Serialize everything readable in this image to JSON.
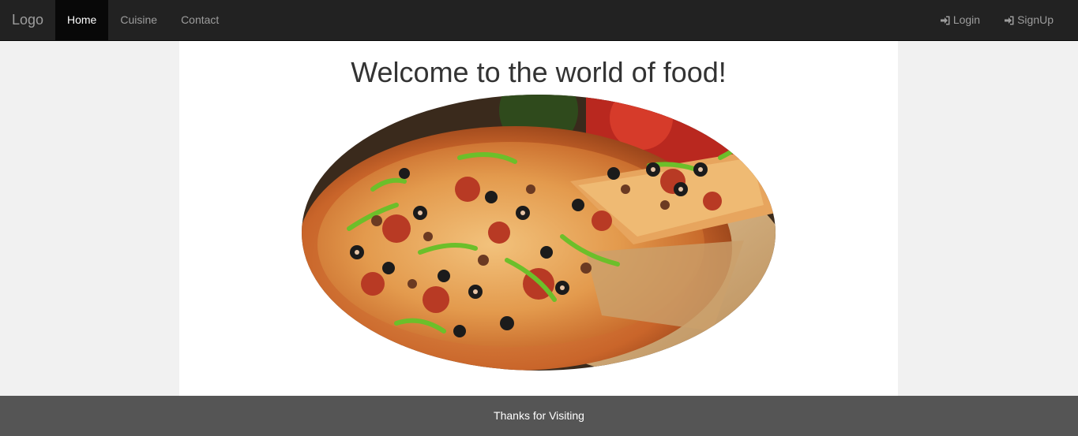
{
  "navbar": {
    "brand": "Logo",
    "items": [
      {
        "label": "Home",
        "active": true
      },
      {
        "label": "Cuisine",
        "active": false
      },
      {
        "label": "Contact",
        "active": false
      }
    ],
    "right_items": [
      {
        "label": "Login",
        "icon": "log-in-icon"
      },
      {
        "label": "SignUp",
        "icon": "log-in-icon"
      }
    ]
  },
  "main": {
    "title": "Welcome to the world of food!",
    "hero_image": "pizza-image"
  },
  "footer": {
    "text": "Thanks for Visiting"
  },
  "colors": {
    "navbar_bg": "#222222",
    "nav_active_bg": "#080808",
    "nav_text": "#9d9d9d",
    "page_bg": "#f1f1f1",
    "content_bg": "#ffffff",
    "footer_bg": "#555555"
  }
}
